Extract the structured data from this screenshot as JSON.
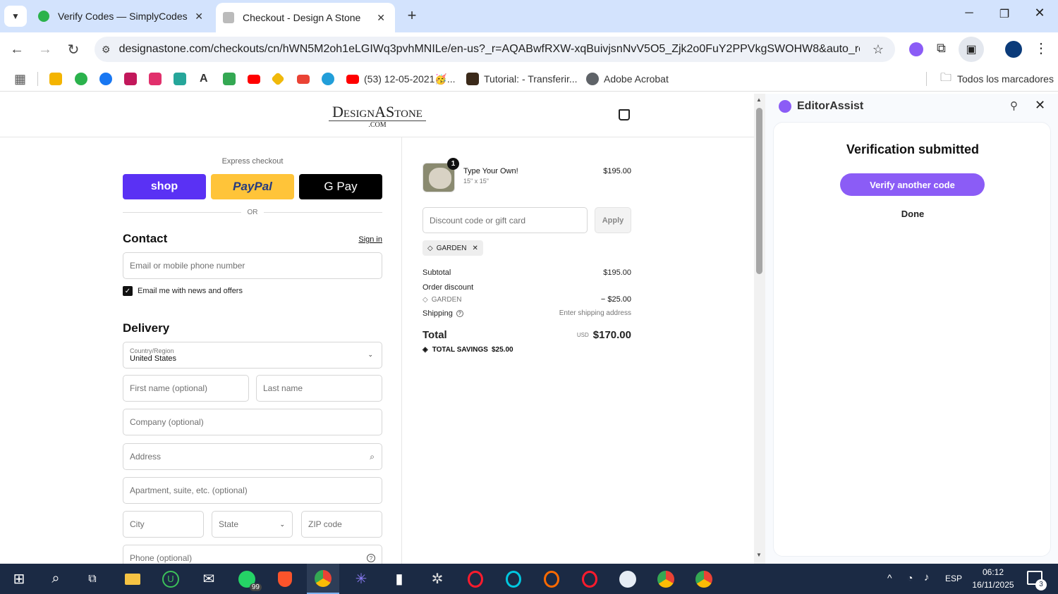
{
  "browser": {
    "tabs": [
      {
        "title": "Verify Codes — SimplyCodes",
        "icon": "simplycodes-icon",
        "active": false
      },
      {
        "title": "Checkout - Design A Stone",
        "icon": "designastone-icon",
        "active": true
      }
    ],
    "url": "designastone.com/checkouts/cn/hWN5M2oh1eLGIWq3pvhMNILe/en-us?_r=AQABwfRXW-xqBuivjsnNvV5O5_Zjk2o0FuY2PPVkgSWOHW8&auto_redirect...",
    "bookmarks": [
      {
        "label": "",
        "icon": "classroom-icon",
        "color": "#f4b400"
      },
      {
        "label": "",
        "icon": "simplycodes-icon",
        "color": "#2bb24c"
      },
      {
        "label": "",
        "icon": "facebook-icon",
        "color": "#1877f2"
      },
      {
        "label": "",
        "icon": "ext-icon",
        "color": "#c2185b"
      },
      {
        "label": "",
        "icon": "instagram-icon",
        "color": "#e1306c"
      },
      {
        "label": "",
        "icon": "app-icon",
        "color": "#26a69a"
      },
      {
        "label": "",
        "icon": "a-icon",
        "color": "#111111"
      },
      {
        "label": "",
        "icon": "maps-icon",
        "color": "#34a853"
      },
      {
        "label": "",
        "icon": "youtube-icon",
        "color": "#ff0000"
      },
      {
        "label": "",
        "icon": "binance-icon",
        "color": "#f0b90b"
      },
      {
        "label": "",
        "icon": "gmail-icon",
        "color": "#ea4335"
      },
      {
        "label": "",
        "icon": "telegram-icon",
        "color": "#229ed9"
      },
      {
        "label": "(53) 12-05-2021🥳...",
        "icon": "youtube-icon",
        "color": "#ff0000"
      },
      {
        "label": "Tutorial: - Transferir...",
        "icon": "fb-icon",
        "color": "#3b2a1a"
      },
      {
        "label": "Adobe Acrobat",
        "icon": "globe-icon",
        "color": "#5f6368"
      }
    ],
    "all_bookmarks_label": "Todos los marcadores"
  },
  "checkout": {
    "logo": {
      "main": "DesignAStone",
      "sub": ".COM"
    },
    "express_label": "Express checkout",
    "shop_label": "shop",
    "paypal_label": "PayPal",
    "gpay_label": "G Pay",
    "or_label": "OR",
    "contact": {
      "heading": "Contact",
      "sign_in": "Sign in",
      "email_placeholder": "Email or mobile phone number",
      "newsletter_label": "Email me with news and offers"
    },
    "delivery": {
      "heading": "Delivery",
      "country_label": "Country/Region",
      "country_value": "United States",
      "first_name": "First name (optional)",
      "last_name": "Last name",
      "company": "Company (optional)",
      "address": "Address",
      "apartment": "Apartment, suite, etc. (optional)",
      "city": "City",
      "state": "State",
      "zip": "ZIP code",
      "phone": "Phone (optional)"
    },
    "summary": {
      "quantity_badge": "1",
      "product_name": "Type Your Own!",
      "product_variant": "15\" x 15\"",
      "product_price": "$195.00",
      "discount_placeholder": "Discount code or gift card",
      "apply_label": "Apply",
      "applied_code": "GARDEN",
      "subtotal_label": "Subtotal",
      "subtotal_value": "$195.00",
      "order_discount_label": "Order discount",
      "discount_code": "GARDEN",
      "discount_value": "− $25.00",
      "shipping_label": "Shipping",
      "shipping_value": "Enter shipping address",
      "total_label": "Total",
      "currency": "USD",
      "total_value": "$170.00",
      "savings_label": "TOTAL SAVINGS",
      "savings_value": "$25.00"
    }
  },
  "side_panel": {
    "title": "EditorAssist",
    "heading": "Verification submitted",
    "verify_button": "Verify another code",
    "done_label": "Done",
    "accent": "#8b5cf6"
  },
  "taskbar": {
    "whatsapp_badge": "99",
    "language": "ESP",
    "time": "06:12",
    "date": "16/11/2025",
    "notification_count": "3"
  }
}
